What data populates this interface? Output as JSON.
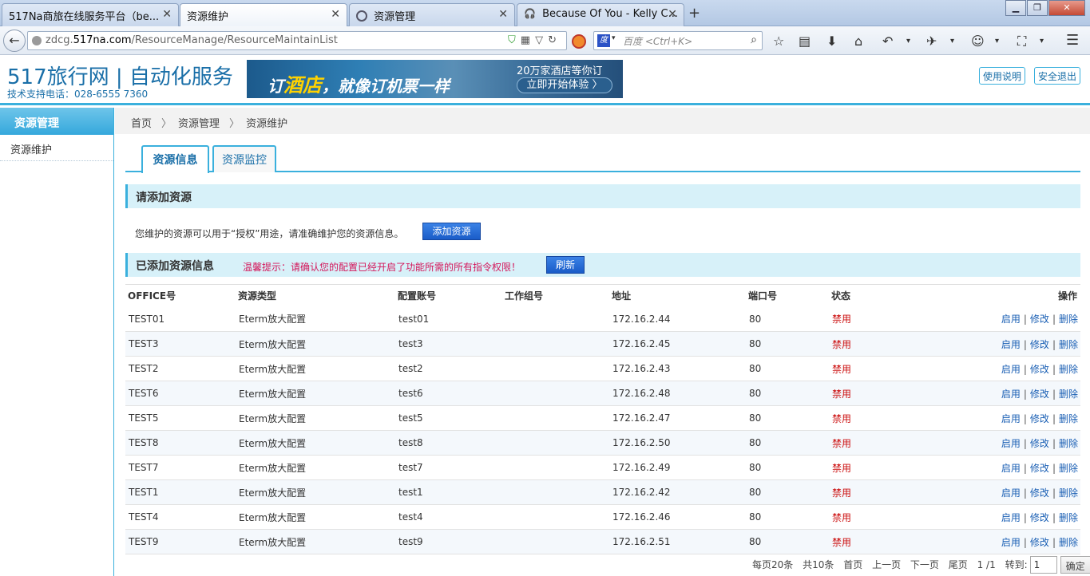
{
  "browser": {
    "tabs": [
      {
        "label": "517Na商旅在线服务平台（be..."
      },
      {
        "label": "资源维护"
      },
      {
        "label": "资源管理"
      },
      {
        "label": "Because Of You - Kelly C..."
      }
    ],
    "url_prefix": "zdcg.",
    "url_domain": "517na.com",
    "url_path": "/ResourceManage/ResourceMaintainList",
    "search_placeholder": "百度 <Ctrl+K>"
  },
  "header": {
    "logo": "517旅行网 | 自动化服务",
    "hotline": "技术支持电话：028-6555 7360",
    "banner_main_pre": "订",
    "banner_main_hot": "酒店",
    "banner_main_post": "，就像订机票一样",
    "banner_sub": "20万家酒店等你订",
    "banner_btn": "立即开始体验 〉",
    "help_btn": "使用说明",
    "logout_btn": "安全退出"
  },
  "sidebar": {
    "title": "资源管理",
    "items": [
      {
        "label": "资源维护"
      }
    ]
  },
  "breadcrumb": [
    "首页",
    "资源管理",
    "资源维护"
  ],
  "tabs": [
    {
      "label": "资源信息"
    },
    {
      "label": "资源监控"
    }
  ],
  "add_section": {
    "title": "请添加资源",
    "desc": "您维护的资源可以用于“授权”用途，请准确维护您的资源信息。",
    "add_btn": "添加资源"
  },
  "list_section": {
    "title": "已添加资源信息",
    "notice": "温馨提示：请确认您的配置已经开启了功能所需的所有指令权限！",
    "refresh_btn": "刷新"
  },
  "table": {
    "columns": [
      "OFFICE号",
      "资源类型",
      "配置账号",
      "工作组号",
      "地址",
      "端口号",
      "状态",
      "操作"
    ],
    "rows": [
      {
        "office": "TEST01",
        "type": "Eterm放大配置",
        "account": "test01",
        "group": "",
        "address": "172.16.2.44",
        "port": "80",
        "status": "禁用"
      },
      {
        "office": "TEST3",
        "type": "Eterm放大配置",
        "account": "test3",
        "group": "",
        "address": "172.16.2.45",
        "port": "80",
        "status": "禁用"
      },
      {
        "office": "TEST2",
        "type": "Eterm放大配置",
        "account": "test2",
        "group": "",
        "address": "172.16.2.43",
        "port": "80",
        "status": "禁用"
      },
      {
        "office": "TEST6",
        "type": "Eterm放大配置",
        "account": "test6",
        "group": "",
        "address": "172.16.2.48",
        "port": "80",
        "status": "禁用"
      },
      {
        "office": "TEST5",
        "type": "Eterm放大配置",
        "account": "test5",
        "group": "",
        "address": "172.16.2.47",
        "port": "80",
        "status": "禁用"
      },
      {
        "office": "TEST8",
        "type": "Eterm放大配置",
        "account": "test8",
        "group": "",
        "address": "172.16.2.50",
        "port": "80",
        "status": "禁用"
      },
      {
        "office": "TEST7",
        "type": "Eterm放大配置",
        "account": "test7",
        "group": "",
        "address": "172.16.2.49",
        "port": "80",
        "status": "禁用"
      },
      {
        "office": "TEST1",
        "type": "Eterm放大配置",
        "account": "test1",
        "group": "",
        "address": "172.16.2.42",
        "port": "80",
        "status": "禁用"
      },
      {
        "office": "TEST4",
        "type": "Eterm放大配置",
        "account": "test4",
        "group": "",
        "address": "172.16.2.46",
        "port": "80",
        "status": "禁用"
      },
      {
        "office": "TEST9",
        "type": "Eterm放大配置",
        "account": "test9",
        "group": "",
        "address": "172.16.2.51",
        "port": "80",
        "status": "禁用"
      }
    ],
    "ops": {
      "enable": "启用",
      "edit": "修改",
      "delete": "删除"
    }
  },
  "pager": {
    "per_page": "每页20条",
    "total": "共10条",
    "first": "首页",
    "prev": "上一页",
    "next": "下一页",
    "last": "尾页",
    "page": "1 /1",
    "jump_label": "转到:",
    "jump_value": "1",
    "ok": "确定"
  },
  "colors": {
    "accent": "#3ab0dd",
    "status_disabled": "#cc1111",
    "notice": "#d4165a",
    "link": "#1a5fb4"
  }
}
